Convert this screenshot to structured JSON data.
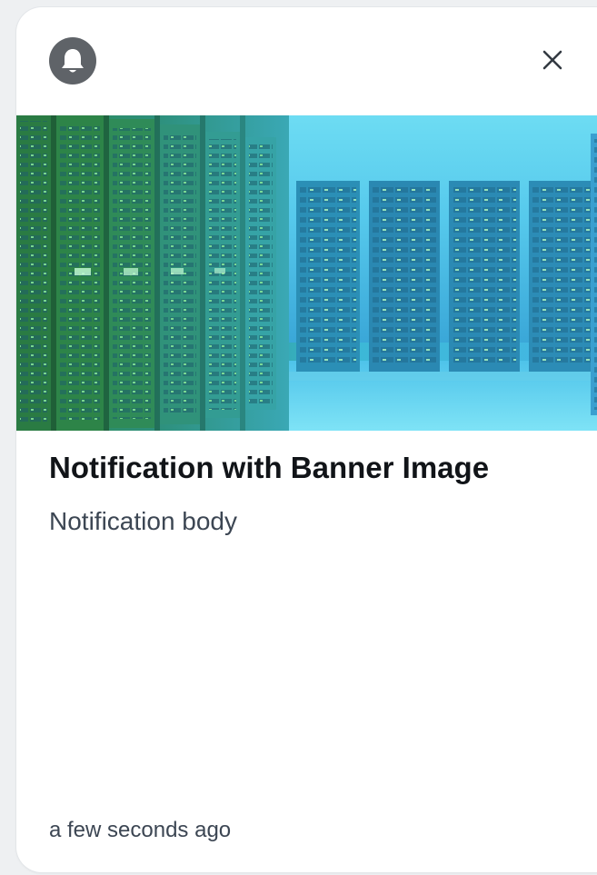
{
  "notification": {
    "icon": "bell-icon",
    "close_icon": "close-icon",
    "banner_image": "server-room-image",
    "title": "Notification with Banner Image",
    "body": "Notification body",
    "timestamp": "a few seconds ago"
  },
  "colors": {
    "badge": "#5f6368",
    "title": "#111418",
    "body": "#3c4653",
    "banner_green": "#2fae4f",
    "banner_cyan": "#5fd6ee"
  }
}
